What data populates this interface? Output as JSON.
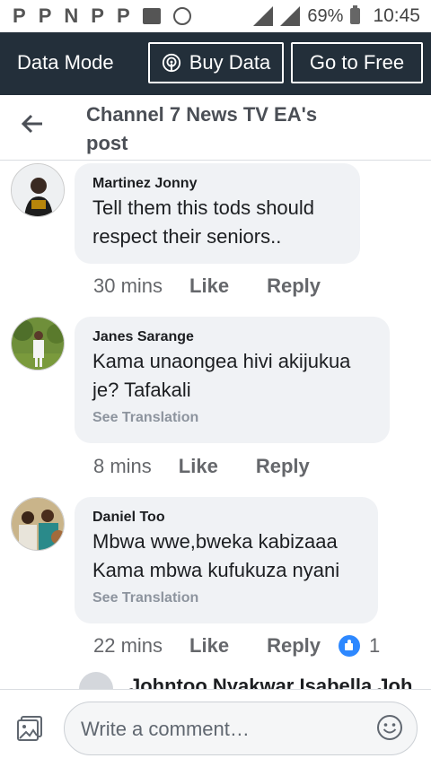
{
  "status_bar": {
    "left_icons": [
      "pinterest-icon",
      "pinterest-icon",
      "nw-icon",
      "pinterest-icon",
      "pinterest-icon",
      "image-icon",
      "whatsapp-icon"
    ],
    "network": "3G",
    "battery": "69%",
    "time": "10:45"
  },
  "data_bar": {
    "mode_label": "Data Mode",
    "buy_label": "Buy Data",
    "free_label": "Go to Free"
  },
  "header": {
    "title": "Channel 7 News TV EA's post"
  },
  "comments": [
    {
      "name": "Martinez Jonny",
      "text": "Tell them this tods should respect their seniors..",
      "translation": "",
      "time": "30 mins",
      "like": "Like",
      "reply": "Reply",
      "reactions": ""
    },
    {
      "name": "Janes Sarange",
      "text": "Kama unaongea hivi akijukua je? Tafakali",
      "translation": "See Translation",
      "time": "8 mins",
      "like": "Like",
      "reply": "Reply",
      "reactions": ""
    },
    {
      "name": "Daniel Too",
      "text": "Mbwa wwe,bweka kabizaaa Kama mbwa kufukuza nyani",
      "translation": "See Translation",
      "time": "22 mins",
      "like": "Like",
      "reply": "Reply",
      "reactions": "1"
    }
  ],
  "partial_reply": {
    "name": "Johntoo Nyakwar Isabella Joh"
  },
  "composer": {
    "placeholder": "Write a comment…"
  },
  "colors": {
    "data_bar_bg": "#232f3a",
    "bubble_bg": "#f0f2f5",
    "like_reaction": "#2d88ff"
  }
}
